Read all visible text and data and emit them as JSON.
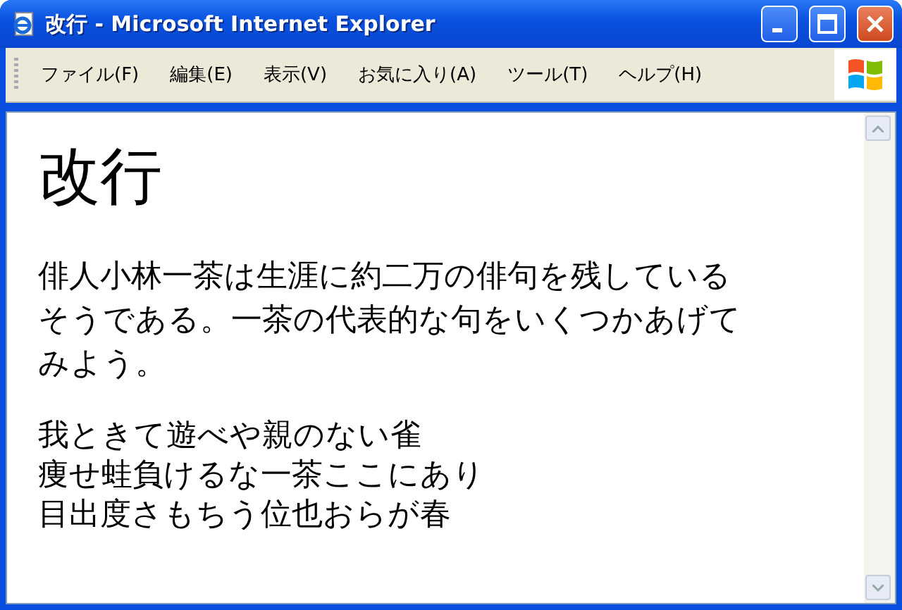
{
  "window": {
    "title": "改行 - Microsoft Internet Explorer"
  },
  "menu_bar": {
    "items": [
      {
        "label": "ファイル(F)"
      },
      {
        "label": "編集(E)"
      },
      {
        "label": "表示(V)"
      },
      {
        "label": "お気に入り(A)"
      },
      {
        "label": "ツール(T)"
      },
      {
        "label": "ヘルプ(H)"
      }
    ]
  },
  "page": {
    "heading": "改行",
    "paragraph": "俳人小林一茶は生涯に約二万の俳句を残しているそうである。一茶の代表的な句をいくつかあげてみよう。",
    "haiku_lines": [
      "我ときて遊べや親のない雀",
      "痩せ蛙負けるな一茶ここにあり",
      "目出度さもちう位也おらが春"
    ]
  }
}
